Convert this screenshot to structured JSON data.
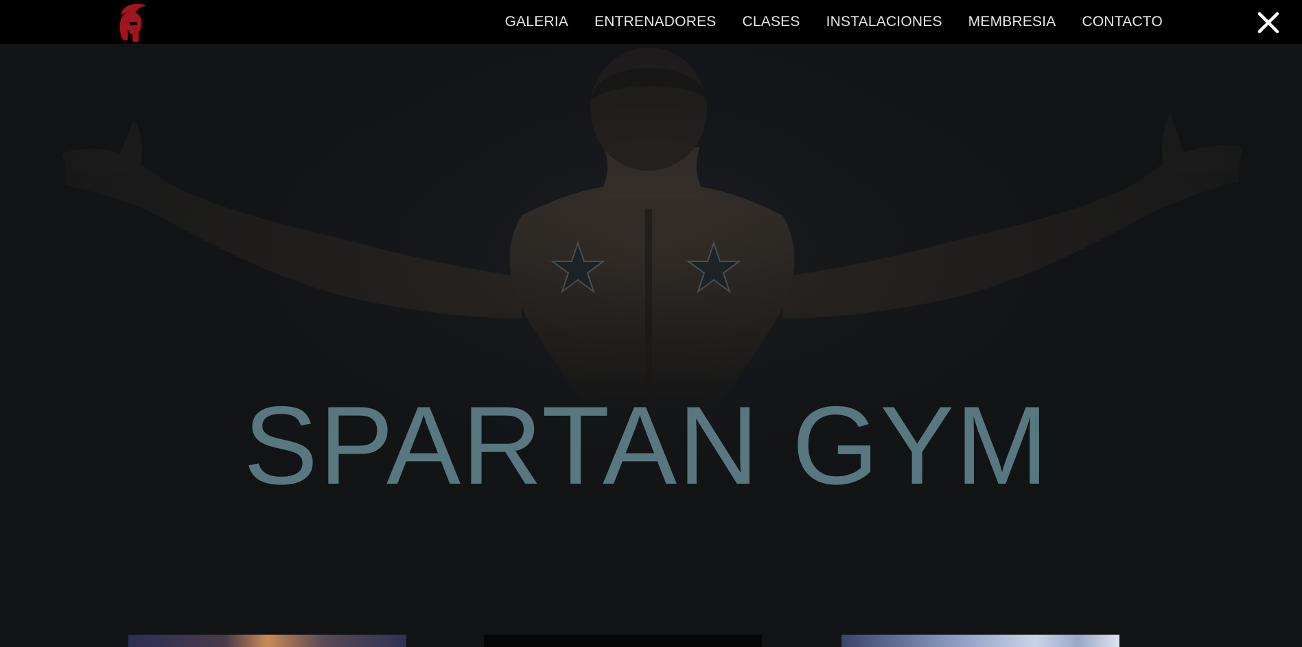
{
  "brand": {
    "logo_icon": "spartan-helmet-icon",
    "logo_color": "#a3151e"
  },
  "nav": {
    "items": [
      {
        "label": "GALERIA"
      },
      {
        "label": "ENTRENADORES"
      },
      {
        "label": "CLASES"
      },
      {
        "label": "INSTALACIONES"
      },
      {
        "label": "MEMBRESIA"
      },
      {
        "label": "CONTACTO"
      }
    ],
    "close_icon": "close-icon"
  },
  "hero": {
    "title": "SPARTAN GYM",
    "title_color": "#587880",
    "background_color": "#111315"
  },
  "gallery": {
    "thumbnails": [
      {
        "icon": "photo-thumbnail"
      },
      {
        "icon": "photo-thumbnail"
      },
      {
        "icon": "photo-thumbnail"
      }
    ]
  }
}
